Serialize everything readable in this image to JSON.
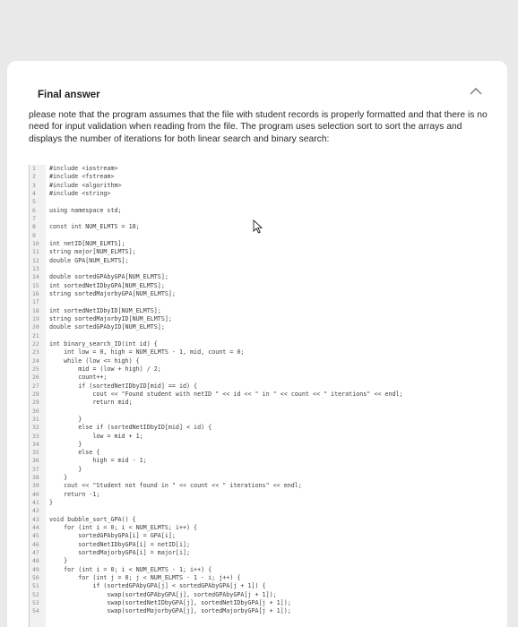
{
  "header": {
    "title": "Final answer"
  },
  "description": "please note that the program assumes that the file with student records is properly formatted and that there is no need for input validation when reading from the file. The program uses selection sort to sort the arrays and displays the number of iterations for both linear search and binary search:",
  "code": [
    {
      "n": "1",
      "t": "#include <iostream>"
    },
    {
      "n": "2",
      "t": "#include <fstream>"
    },
    {
      "n": "3",
      "t": "#include <algorithm>"
    },
    {
      "n": "4",
      "t": "#include <string>"
    },
    {
      "n": "5",
      "t": ""
    },
    {
      "n": "6",
      "t": "using namespace std;"
    },
    {
      "n": "7",
      "t": ""
    },
    {
      "n": "8",
      "t": "const int NUM_ELMTS = 18;"
    },
    {
      "n": "9",
      "t": ""
    },
    {
      "n": "10",
      "t": "int netID[NUM_ELMTS];"
    },
    {
      "n": "11",
      "t": "string major[NUM_ELMTS];"
    },
    {
      "n": "12",
      "t": "double GPA[NUM_ELMTS];"
    },
    {
      "n": "13",
      "t": ""
    },
    {
      "n": "14",
      "t": "double sortedGPAbyGPA[NUM_ELMTS];"
    },
    {
      "n": "15",
      "t": "int sortedNetIDbyGPA[NUM_ELMTS];"
    },
    {
      "n": "16",
      "t": "string sortedMajorbyGPA[NUM_ELMTS];"
    },
    {
      "n": "17",
      "t": ""
    },
    {
      "n": "18",
      "t": "int sortedNetIDbyID[NUM_ELMTS];"
    },
    {
      "n": "19",
      "t": "string sortedMajorbyID[NUM_ELMTS];"
    },
    {
      "n": "20",
      "t": "double sortedGPAbyID[NUM_ELMTS];"
    },
    {
      "n": "21",
      "t": ""
    },
    {
      "n": "22",
      "t": "int binary_search_ID(int id) {"
    },
    {
      "n": "23",
      "t": "    int low = 0, high = NUM_ELMTS - 1, mid, count = 0;"
    },
    {
      "n": "24",
      "t": "    while (low <= high) {"
    },
    {
      "n": "25",
      "t": "        mid = (low + high) / 2;"
    },
    {
      "n": "26",
      "t": "        count++;"
    },
    {
      "n": "27",
      "t": "        if (sortedNetIDbyID[mid] == id) {"
    },
    {
      "n": "28",
      "t": "            cout << \"Found student with netID \" << id << \" in \" << count << \" iterations\" << endl;"
    },
    {
      "n": "29",
      "t": "            return mid;"
    },
    {
      "n": "30",
      "t": ""
    },
    {
      "n": "31",
      "t": "        }"
    },
    {
      "n": "32",
      "t": "        else if (sortedNetIDbyID[mid] < id) {"
    },
    {
      "n": "33",
      "t": "            low = mid + 1;"
    },
    {
      "n": "34",
      "t": "        }"
    },
    {
      "n": "35",
      "t": "        else {"
    },
    {
      "n": "36",
      "t": "            high = mid - 1;"
    },
    {
      "n": "37",
      "t": "        }"
    },
    {
      "n": "38",
      "t": "    }"
    },
    {
      "n": "39",
      "t": "    cout << \"Student not found in \" << count << \" iterations\" << endl;"
    },
    {
      "n": "40",
      "t": "    return -1;"
    },
    {
      "n": "41",
      "t": "}"
    },
    {
      "n": "42",
      "t": ""
    },
    {
      "n": "43",
      "t": "void bubble_sort_GPA() {"
    },
    {
      "n": "44",
      "t": "    for (int i = 0; i < NUM_ELMTS; i++) {"
    },
    {
      "n": "45",
      "t": "        sortedGPAbyGPA[i] = GPA[i];"
    },
    {
      "n": "46",
      "t": "        sortedNetIDbyGPA[i] = netID[i];"
    },
    {
      "n": "47",
      "t": "        sortedMajorbyGPA[i] = major[i];"
    },
    {
      "n": "48",
      "t": "    }"
    },
    {
      "n": "49",
      "t": "    for (int i = 0; i < NUM_ELMTS - 1; i++) {"
    },
    {
      "n": "50",
      "t": "        for (int j = 0; j < NUM_ELMTS - 1 - i; j++) {"
    },
    {
      "n": "51",
      "t": "            if (sortedGPAbyGPA[j] < sortedGPAbyGPA[j + 1]) {"
    },
    {
      "n": "52",
      "t": "                swap(sortedGPAbyGPA[j], sortedGPAbyGPA[j + 1]);"
    },
    {
      "n": "53",
      "t": "                swap(sortedNetIDbyGPA[j], sortedNetIDbyGPA[j + 1]);"
    },
    {
      "n": "54",
      "t": "                swap(sortedMajorbyGPA[j], sortedMajorbyGPA[j + 1]);"
    }
  ]
}
